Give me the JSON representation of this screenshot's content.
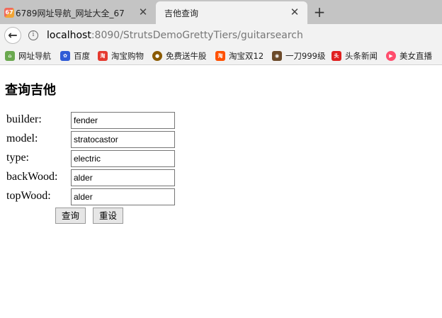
{
  "browser": {
    "tabs": [
      {
        "title": "6789网址导航_网址大全_67",
        "active": false
      },
      {
        "title": "吉他查询",
        "active": true
      }
    ],
    "new_tab": "+",
    "address": {
      "host": "localhost",
      "rest": ":8090/StrutsDemoGrettyTiers/guitarsearch"
    },
    "bookmarks": [
      {
        "label": "网址导航",
        "icon": "green-bird-icon",
        "color": "#6aa84f"
      },
      {
        "label": "百度",
        "icon": "baidu-paw-icon",
        "color": "#2f5bd6"
      },
      {
        "label": "淘宝购物",
        "icon": "taobao-icon",
        "color": "#e53a2f"
      },
      {
        "label": "免费送牛股",
        "icon": "coin-icon",
        "color": "#8a5a00"
      },
      {
        "label": "淘宝双12",
        "icon": "tao-icon",
        "color": "#ff5000"
      },
      {
        "label": "一刀999级",
        "icon": "game-icon",
        "color": "#6b4a2a"
      },
      {
        "label": "头条新闻",
        "icon": "toutiao-icon",
        "color": "#e0201f"
      },
      {
        "label": "美女直播",
        "icon": "live-icon",
        "color": "#ff4d6d"
      }
    ]
  },
  "page": {
    "title": "查询吉他",
    "fields": [
      {
        "label": "builder:",
        "value": "fender"
      },
      {
        "label": "model:",
        "value": "stratocastor"
      },
      {
        "label": "type:",
        "value": "electric"
      },
      {
        "label": "backWood:",
        "value": "alder"
      },
      {
        "label": "topWood:",
        "value": "alder"
      }
    ],
    "submit_label": "查询",
    "reset_label": "重设"
  }
}
